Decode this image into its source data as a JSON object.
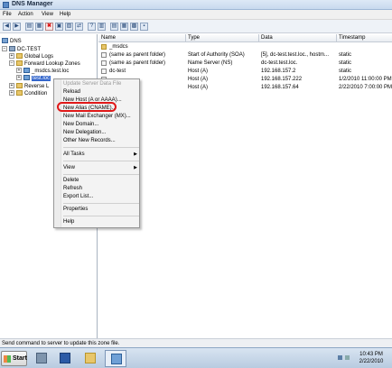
{
  "window": {
    "title": "DNS Manager"
  },
  "menu": [
    "File",
    "Action",
    "View",
    "Help"
  ],
  "toolbar": {
    "buttons": [
      "◀",
      "▶",
      "▤",
      "▦",
      "✖",
      "▣",
      "▧",
      "⇄",
      "?",
      "▥",
      "▤",
      "▦",
      "▩",
      "▪"
    ]
  },
  "tree": {
    "items": [
      {
        "label": "DNS",
        "exp": "",
        "icon": "dns"
      },
      {
        "label": "DC-TEST",
        "exp": "−",
        "icon": "server"
      },
      {
        "label": "Global Logs",
        "exp": "+",
        "icon": "folder"
      },
      {
        "label": "Forward Lookup Zones",
        "exp": "−",
        "icon": "folder"
      },
      {
        "label": "_msdcs.test.loc",
        "exp": "+",
        "icon": "zone"
      },
      {
        "label": "test.loc",
        "exp": "+",
        "icon": "zone"
      },
      {
        "label": "Reverse L",
        "exp": "+",
        "icon": "folder"
      },
      {
        "label": "Condition",
        "exp": "+",
        "icon": "folder"
      }
    ]
  },
  "list": {
    "columns": [
      "Name",
      "Type",
      "Data",
      "Timestamp"
    ],
    "rows": [
      {
        "name": "_msdcs",
        "type": "",
        "data": "",
        "timestamp": "",
        "folder": true
      },
      {
        "name": "(same as parent folder)",
        "type": "Start of Authority (SOA)",
        "data": "[5], dc-test.test.loc., hostm...",
        "timestamp": "static"
      },
      {
        "name": "(same as parent folder)",
        "type": "Name Server (NS)",
        "data": "dc-test.test.loc.",
        "timestamp": "static"
      },
      {
        "name": "dc-test",
        "type": "Host (A)",
        "data": "192.168.157.2",
        "timestamp": "static"
      },
      {
        "name": "",
        "type": "Host (A)",
        "data": "192.168.157.222",
        "timestamp": "1/2/2010 11:00:00 PM"
      },
      {
        "name": "",
        "type": "Host (A)",
        "data": "192.168.157.64",
        "timestamp": "2/22/2010 7:00:00 PM"
      }
    ]
  },
  "context_menu": {
    "items": [
      {
        "label": "Update Server Data File",
        "disabled": true,
        "arrow": ""
      },
      {
        "label": "Reload",
        "disabled": false,
        "arrow": ""
      },
      {
        "label": "New Host (A or AAAA)...",
        "disabled": false,
        "arrow": ""
      },
      {
        "label": "New Alias (CNAME)...",
        "disabled": false,
        "arrow": ""
      },
      {
        "label": "New Mail Exchanger (MX)...",
        "disabled": false,
        "arrow": ""
      },
      {
        "label": "New Domain...",
        "disabled": false,
        "arrow": ""
      },
      {
        "label": "New Delegation...",
        "disabled": false,
        "arrow": ""
      },
      {
        "label": "Other New Records...",
        "disabled": false,
        "arrow": ""
      },
      {
        "label": "All Tasks",
        "disabled": false,
        "arrow": "▶"
      },
      {
        "label": "View",
        "disabled": false,
        "arrow": "▶"
      },
      {
        "label": "Delete",
        "disabled": false,
        "arrow": ""
      },
      {
        "label": "Refresh",
        "disabled": false,
        "arrow": ""
      },
      {
        "label": "Export List...",
        "disabled": false,
        "arrow": ""
      },
      {
        "label": "Properties",
        "disabled": false,
        "arrow": ""
      },
      {
        "label": "Help",
        "disabled": false,
        "arrow": ""
      }
    ]
  },
  "status": {
    "text": "Send command to server to update this zone file."
  },
  "taskbar": {
    "start_label": "Start",
    "clock_time": "10:43 PM",
    "clock_date": "2/22/2010"
  },
  "colors": {
    "highlight": "#e01818",
    "selection": "#3366cc"
  }
}
